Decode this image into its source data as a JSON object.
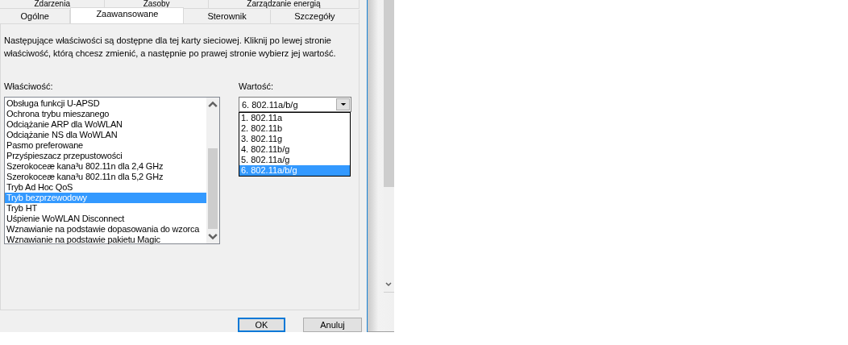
{
  "tabs_row_1": [
    {
      "label": "Zdarzenia"
    },
    {
      "label": "Zasoby"
    },
    {
      "label": "Zarządzanie energią"
    }
  ],
  "tabs_row_2": [
    {
      "label": "Ogólne",
      "selected": false
    },
    {
      "label": "Zaawansowane",
      "selected": true
    },
    {
      "label": "Sterownik",
      "selected": false
    },
    {
      "label": "Szczegóły",
      "selected": false
    }
  ],
  "description": "Następujące właściwości są dostępne dla tej karty sieciowej. Kliknij po lewej stronie właściwość, którą chcesz zmienić, a następnie po prawej stronie wybierz jej wartość.",
  "property_label": "Właściwość:",
  "properties": [
    {
      "label": "Obsługa funkcji U-APSD",
      "selected": false
    },
    {
      "label": "Ochrona trybu mieszanego",
      "selected": false
    },
    {
      "label": "Odciążanie ARP dla WoWLAN",
      "selected": false
    },
    {
      "label": "Odciążanie NS dla WoWLAN",
      "selected": false
    },
    {
      "label": "Pasmo preferowane",
      "selected": false
    },
    {
      "label": "Przyśpieszacz przepustowości",
      "selected": false
    },
    {
      "label": "Szerokoceæ kana³u 802.11n dla 2,4 GHz",
      "selected": false
    },
    {
      "label": "Szerokoceæ kana³u 802.11n dla 5,2 GHz",
      "selected": false
    },
    {
      "label": "Tryb Ad Hoc QoS",
      "selected": false
    },
    {
      "label": "Tryb bezprzewodowy",
      "selected": true
    },
    {
      "label": "Tryb HT",
      "selected": false
    },
    {
      "label": "Uśpienie WoWLAN Disconnect",
      "selected": false
    },
    {
      "label": "Wznawianie na podstawie dopasowania do wzorca",
      "selected": false
    },
    {
      "label": "Wznawianie na podstawie pakietu Magic",
      "selected": false
    }
  ],
  "value_label": "Wartość:",
  "value_combo": {
    "value": "6. 802.11a/b/g",
    "expanded": true
  },
  "value_options": [
    {
      "label": "1. 802.11a",
      "selected": false
    },
    {
      "label": "2. 802.11b",
      "selected": false
    },
    {
      "label": "3. 802.11g",
      "selected": false
    },
    {
      "label": "4. 802.11b/g",
      "selected": false
    },
    {
      "label": "5. 802.11a/g",
      "selected": false
    },
    {
      "label": "6. 802.11a/b/g",
      "selected": true
    }
  ],
  "buttons": [
    {
      "label": "OK",
      "kind": "default"
    },
    {
      "label": "Anuluj",
      "kind": "normal"
    }
  ]
}
